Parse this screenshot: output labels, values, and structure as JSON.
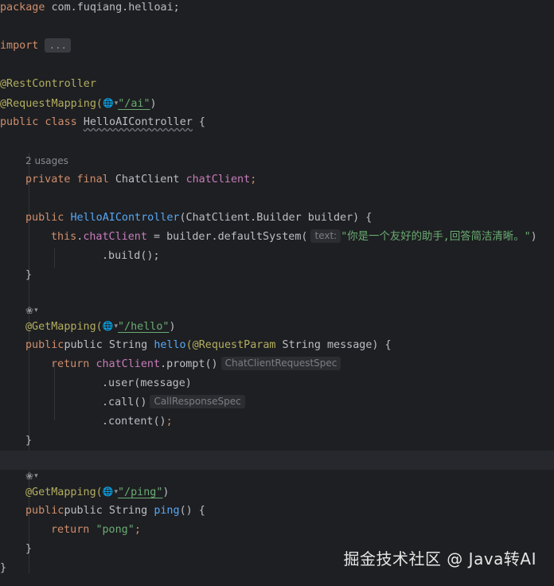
{
  "code": {
    "package_kw": "package",
    "package_name": " com.fuqiang.helloai;",
    "import_kw": "import",
    "import_fold": "...",
    "ann_rest": "@RestController",
    "ann_reqmap": "@RequestMapping(",
    "reqmap_path": "\"/ai\"",
    "close_paren": ")",
    "public_class": "public class ",
    "class_name": "HelloAIController",
    "open_brace": " {",
    "usages": "2 usages",
    "private_final": "private final ",
    "chatclient_type": "ChatClient ",
    "chatclient_field": "chatClient",
    "semicolon": ";",
    "public_kw": "public ",
    "ctor_name": "HelloAIController",
    "ctor_params": "(ChatClient.Builder builder) {",
    "this_kw": "this",
    "dot": ".",
    "assign_builder": " = builder.defaultSystem(",
    "hint_text": "text:",
    "system_prompt": "\"你是一个友好的助手,回答简洁清晰。\"",
    "build_call": ".build();",
    "close_brace": "}",
    "ann_get": "@GetMapping(",
    "hello_path": "\"/hello\"",
    "public_string": "public String ",
    "hello_name": "hello",
    "ann_reqparam": "(@RequestParam",
    "hello_params": " String message) {",
    "return_kw": "return ",
    "prompt_call": ".prompt()",
    "hint_prompt": "ChatClientRequestSpec",
    "user_call": ".user(message)",
    "call_call": ".call()",
    "hint_call": "CallResponseSpec",
    "content_call": ".content()",
    "ping_path": "\"/ping\"",
    "ping_name": "ping",
    "ping_params": "() {",
    "pong_str": "\"pong\""
  },
  "icons": {
    "globe": "globe-icon",
    "chevron": "chevron-down-icon",
    "bean": "spring-bean-icon"
  },
  "watermark": "掘金技术社区 @ Java转AI",
  "colors": {
    "background": "#1e1f22",
    "keyword": "#cf8e6d",
    "annotation": "#b3ae60",
    "string": "#6aab73",
    "method": "#56a8f5",
    "field": "#c77dbb"
  }
}
